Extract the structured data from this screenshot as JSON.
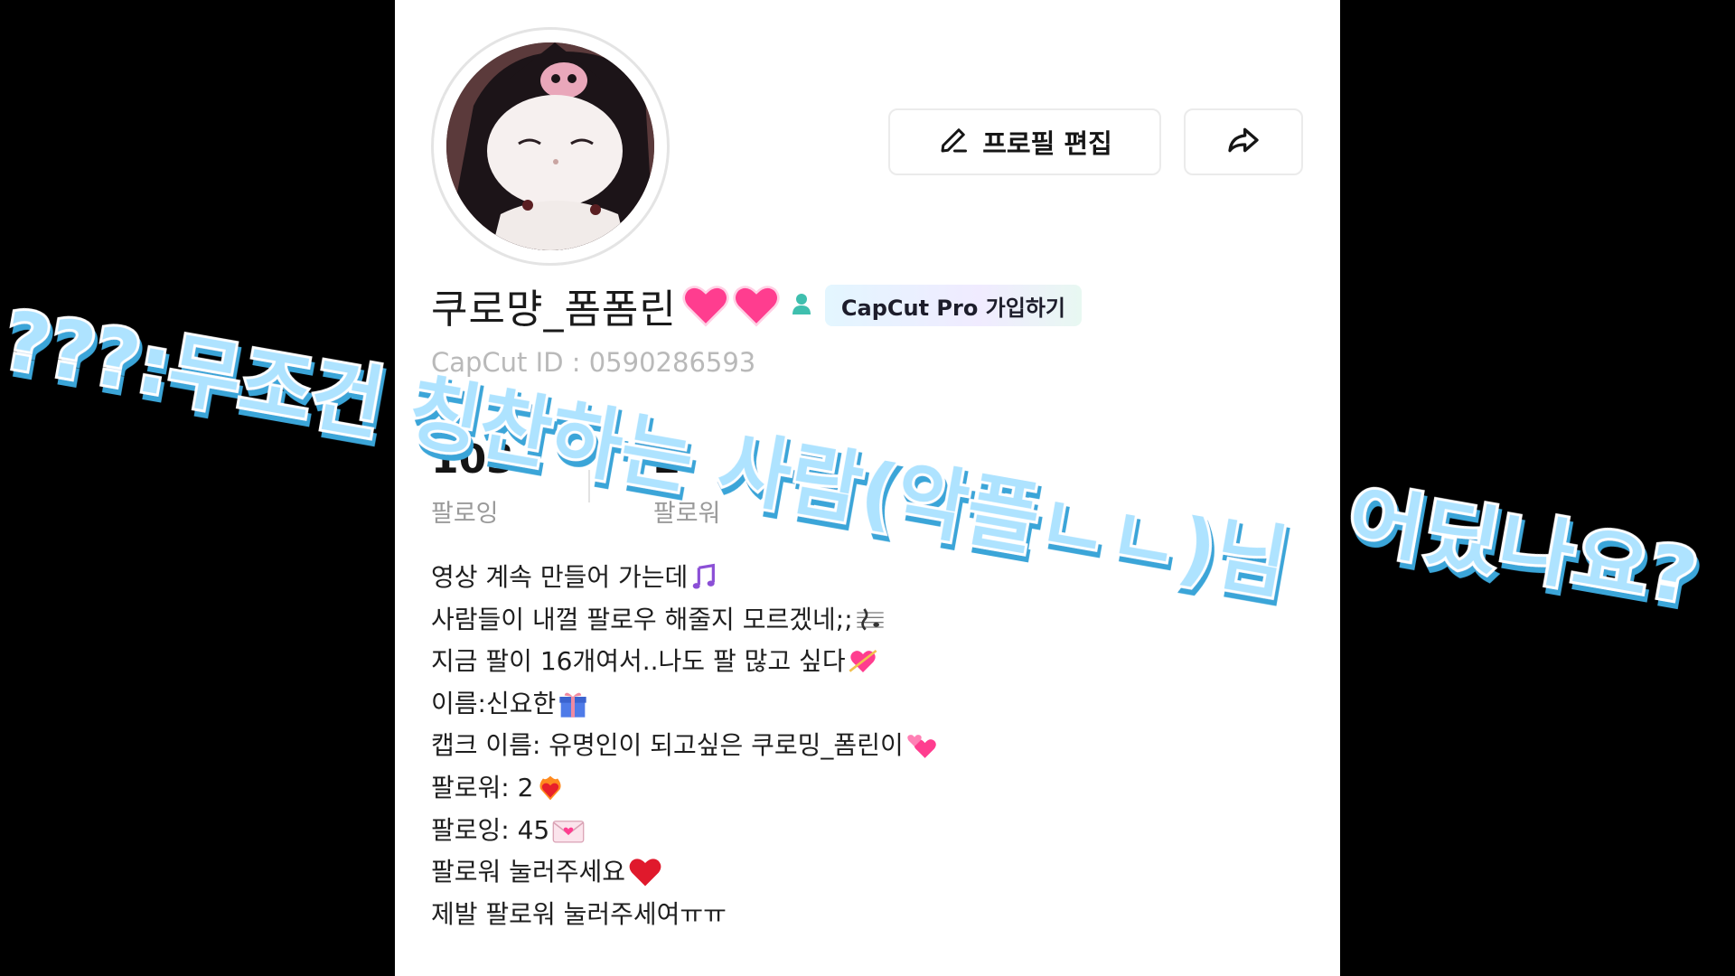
{
  "profile": {
    "username": "쿠로먕_폼폼린",
    "pro_badge_label": "CapCut Pro 가입하기",
    "capcut_id": "CapCut ID : 0590286593",
    "edit_button_label": "프로필 편집",
    "stats": [
      {
        "value": "103",
        "label": "팔로잉"
      },
      {
        "value": "2",
        "label": "팔로워"
      }
    ],
    "bio_lines": [
      {
        "text": "영상 계속 만들어 가는데",
        "icon": "music-notes-icon"
      },
      {
        "text": "사람들이 내껄 팔로우 해줄지 모르겠네;;",
        "icon": "music-score-icon"
      },
      {
        "text": "지금 팔이 16개여서..나도 팔 많고 싶다",
        "icon": "heart-arrow-icon"
      },
      {
        "text": "이름:신요한",
        "icon": "gift-icon"
      },
      {
        "text": "캡크 이름: 유명인이 되고싶은 쿠로밍_폼린이",
        "icon": "two-hearts-icon"
      },
      {
        "text": "팔로워: 2",
        "icon": "heart-on-fire-icon"
      },
      {
        "text": "팔로잉: 45",
        "icon": "love-letter-icon"
      },
      {
        "text": "팔로워 눌러주세요",
        "icon": "red-heart-icon"
      },
      {
        "text": "제발 팔로워 눌러주세여ㅠㅠ",
        "icon": ""
      }
    ]
  },
  "overlay_caption": {
    "part1": "???:무조건 칭찬하는 사람(악플ㄴㄴ)님",
    "part2": "어딨나요?"
  },
  "colors": {
    "overlay_text_fill": "#aee3ff",
    "overlay_text_stroke": "#ffffff",
    "overlay_text_shadow": "#3aa5d8",
    "badge_text": "#1d1d2b"
  }
}
